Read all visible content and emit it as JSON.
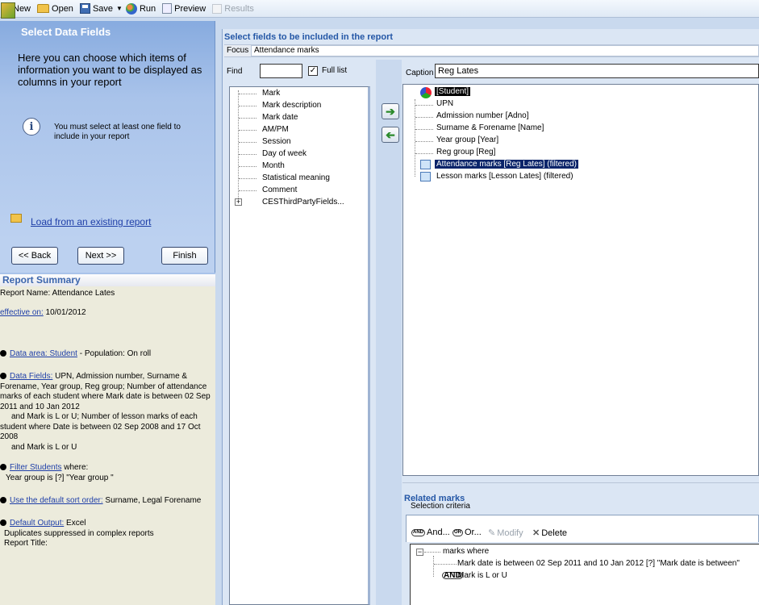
{
  "toolbar": {
    "new": "New",
    "open": "Open",
    "save": "Save",
    "run": "Run",
    "preview": "Preview",
    "results": "Results"
  },
  "wizard": {
    "title": "Select Data Fields",
    "description": "Here you can choose which items of information you want to be displayed as columns in your report",
    "info_text": "You must select at least one field to include in your report",
    "load_link": "Load from an existing report",
    "back": "<< Back",
    "next": "Next >>",
    "finish": "Finish"
  },
  "summary": {
    "title": "Report Summary",
    "report_name": "Report Name: Attendance Lates",
    "effective_link": "effective on:",
    "effective_date": " 10/01/2012",
    "data_area_link": "Data area: Student",
    "data_area_rest": " - Population: On roll",
    "data_fields_link": "Data Fields:",
    "data_fields_l1": " UPN, Admission number, Surname &",
    "data_fields_l2": "Forename, Year group, Reg group; Number of attendance",
    "data_fields_l3": "marks of each student where Mark date is between 02 Sep",
    "data_fields_l4": "2011 and 10 Jan 2012",
    "data_fields_l5": "and Mark is L or U; Number of lesson marks of each",
    "data_fields_l6": "student where Date is between 02 Sep 2008 and 17 Oct",
    "data_fields_l7": "2008",
    "data_fields_l8": "and Mark is L or U",
    "filter_link": "Filter Students",
    "filter_rest": " where:",
    "filter_cond": "Year group is  [?] \"Year group \"",
    "sort_link": "Use the default sort order:",
    "sort_rest": " Surname, Legal Forename",
    "output_link": "Default Output:",
    "output_rest": " Excel",
    "dup_line": "Duplicates suppressed in complex reports",
    "report_title": "Report Title:"
  },
  "main": {
    "title": "Select fields to be included in the report",
    "focus_label": "Focus",
    "focus_value": "Attendance marks",
    "find_label": "Find",
    "find_value": "",
    "full_list_label": "Full list",
    "full_list_checked": true,
    "caption_label": "Caption",
    "caption_value": "Reg Lates",
    "field_items": [
      "Mark",
      "Mark description",
      "Mark date",
      "AM/PM",
      "Session",
      "Day of week",
      "Month",
      "Statistical meaning",
      "Comment",
      "CESThirdPartyFields..."
    ],
    "selected_items": [
      "[Student]",
      "UPN",
      "Admission number [Adno]",
      "Surname & Forename [Name]",
      "Year group [Year]",
      "Reg group [Reg]",
      "Attendance marks [Reg Lates] (filtered)",
      "Lesson marks [Lesson Lates] (filtered)"
    ]
  },
  "related": {
    "title": "Related marks",
    "subtitle": "Selection criteria",
    "and_btn": "And...",
    "or_btn": "Or...",
    "modify_btn": "Modify",
    "delete_btn": "Delete",
    "criteria_root": "marks where",
    "criteria_1": "Mark date is between 02 Sep 2011 and 10 Jan 2012 [?] \"Mark date is between\"",
    "criteria_2": "Mark is L or U"
  },
  "colors": {
    "wizard_gradient_top": "#87abdf",
    "heading_blue": "#2457a6",
    "summary_bg": "#ecebdc",
    "selection_highlight": "#0a246a"
  },
  "icons": {
    "add_arrow": "right-arrow-icon",
    "remove_arrow": "left-arrow-icon",
    "info": "info-icon"
  }
}
